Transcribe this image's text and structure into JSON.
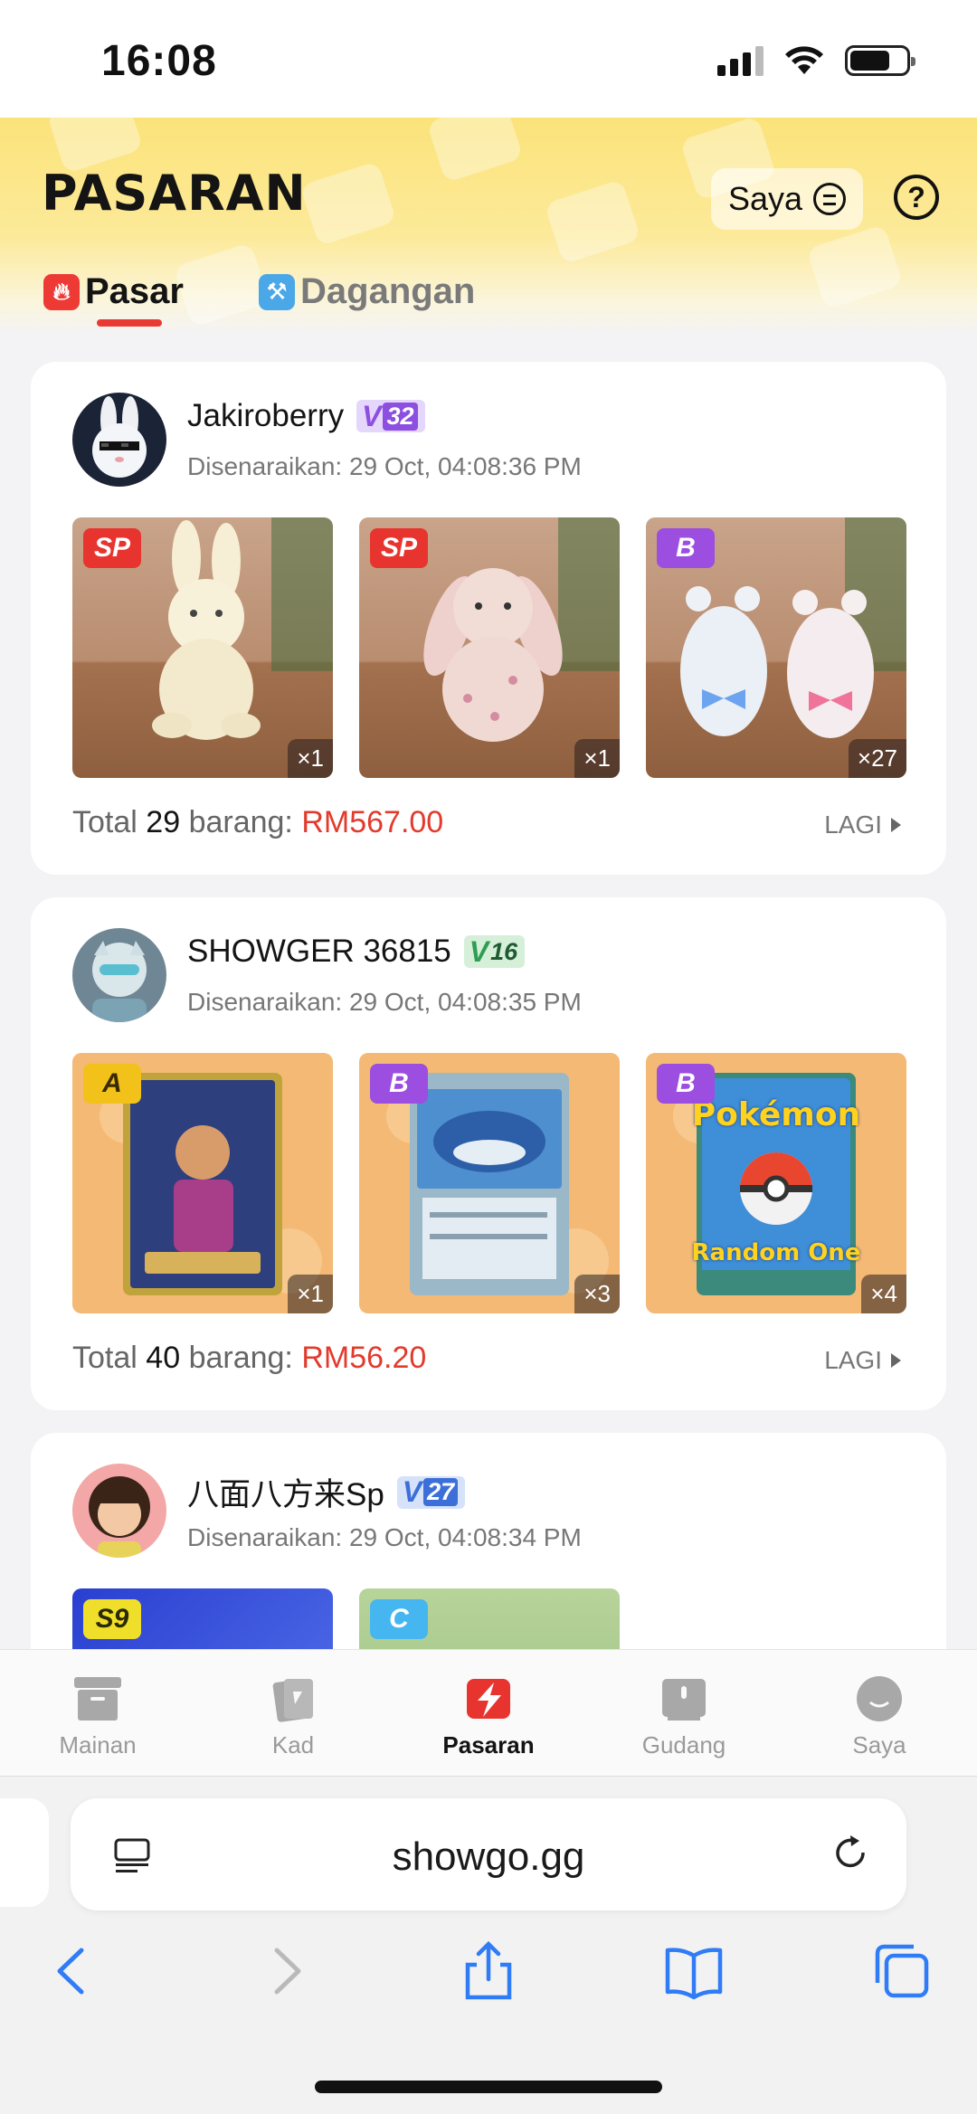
{
  "status": {
    "time": "16:08"
  },
  "header": {
    "title": "PASARAN",
    "saya_label": "Saya",
    "tabs": [
      {
        "label": "Pasar",
        "active": true
      },
      {
        "label": "Dagangan",
        "active": false
      }
    ]
  },
  "listings": [
    {
      "user": "Jakiroberry",
      "vip_level": "32",
      "vip_color": "#8d4fe0",
      "listed_at": "Disenaraikan: 29 Oct, 04:08:36 PM",
      "items": [
        {
          "rarity": "SP",
          "rarity_color": "#e8342f",
          "qty": "×1",
          "image": "cream-bunny-plush"
        },
        {
          "rarity": "SP",
          "rarity_color": "#e8342f",
          "qty": "×1",
          "image": "floral-bunny-plush"
        },
        {
          "rarity": "B",
          "rarity_color": "#9b4ee0",
          "qty": "×27",
          "image": "bear-figures"
        }
      ],
      "total_prefix": "Total",
      "total_count": "29",
      "total_mid": "barang:",
      "total_price": "RM567.00",
      "more_label": "LAGI"
    },
    {
      "user": "SHOWGER 36815",
      "vip_level": "16",
      "vip_color": "#2f9e54",
      "listed_at": "Disenaraikan: 29 Oct, 04:08:35 PM",
      "items": [
        {
          "rarity": "A",
          "rarity_color": "#f2c21a",
          "qty": "×1",
          "image": "trainer-card"
        },
        {
          "rarity": "B",
          "rarity_color": "#9b4ee0",
          "qty": "×3",
          "image": "ex-pokemon-card"
        },
        {
          "rarity": "B",
          "rarity_color": "#9b4ee0",
          "qty": "×4",
          "image": "pokemon-random-one",
          "card_text_1": "Pokémon",
          "card_text_2": "Random One"
        }
      ],
      "total_prefix": "Total",
      "total_count": "40",
      "total_mid": "barang:",
      "total_price": "RM56.20",
      "more_label": "LAGI"
    },
    {
      "user": "八面八方来Sp",
      "vip_level": "27",
      "vip_color": "#3c6fd8",
      "listed_at": "Disenaraikan: 29 Oct, 04:08:34 PM",
      "items": [
        {
          "rarity": "S9",
          "rarity_color": "#f0df2a"
        },
        {
          "rarity": "C",
          "rarity_color": "#46b6f0"
        }
      ]
    }
  ],
  "bottom_nav": [
    {
      "label": "Mainan",
      "icon": "box-icon",
      "active": false
    },
    {
      "label": "Kad",
      "icon": "cards-icon",
      "active": false
    },
    {
      "label": "Pasaran",
      "icon": "market-bolt-icon",
      "active": true
    },
    {
      "label": "Gudang",
      "icon": "warehouse-icon",
      "active": false
    },
    {
      "label": "Saya",
      "icon": "profile-icon",
      "active": false
    }
  ],
  "browser": {
    "url": "showgo.gg"
  }
}
